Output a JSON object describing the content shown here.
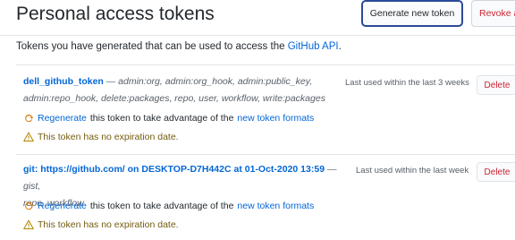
{
  "header": {
    "title": "Personal access tokens",
    "generate_label": "Generate new token",
    "revoke_label": "Revoke al"
  },
  "intro": {
    "text": "Tokens you have generated that can be used to access the ",
    "link": "GitHub API",
    "suffix": "."
  },
  "tokens": [
    {
      "name": "dell_github_token",
      "scopes_line1": " — admin:org, admin:org_hook, admin:public_key,",
      "scopes_line2": "admin:repo_hook, delete:packages, repo, user, workflow, write:packages",
      "last_used": "Last used within the last 3 weeks",
      "delete_label": "Delete",
      "regen_prefix": "Regenerate",
      "regen_middle": " this token to take advantage of the ",
      "regen_link": "new token formats",
      "warning": "This token has no expiration date."
    },
    {
      "name": "git: https://github.com/ on DESKTOP-D7H442C at 01-Oct-2020 13:59",
      "scopes_line1": " — gist,",
      "scopes_line2": "repo, workflow",
      "last_used": "Last used within the last week",
      "delete_label": "Delete",
      "regen_prefix": "Regenerate",
      "regen_middle": " this token to take advantage of the ",
      "regen_link": "new token formats",
      "warning": "This token has no expiration date."
    }
  ],
  "icons": {
    "regenerate": "sync-icon",
    "warning": "alert-icon"
  },
  "colors": {
    "link": "#0366d6",
    "danger": "#cb2431",
    "warning": "#735c0f",
    "focus_border": "#2a4a99"
  }
}
